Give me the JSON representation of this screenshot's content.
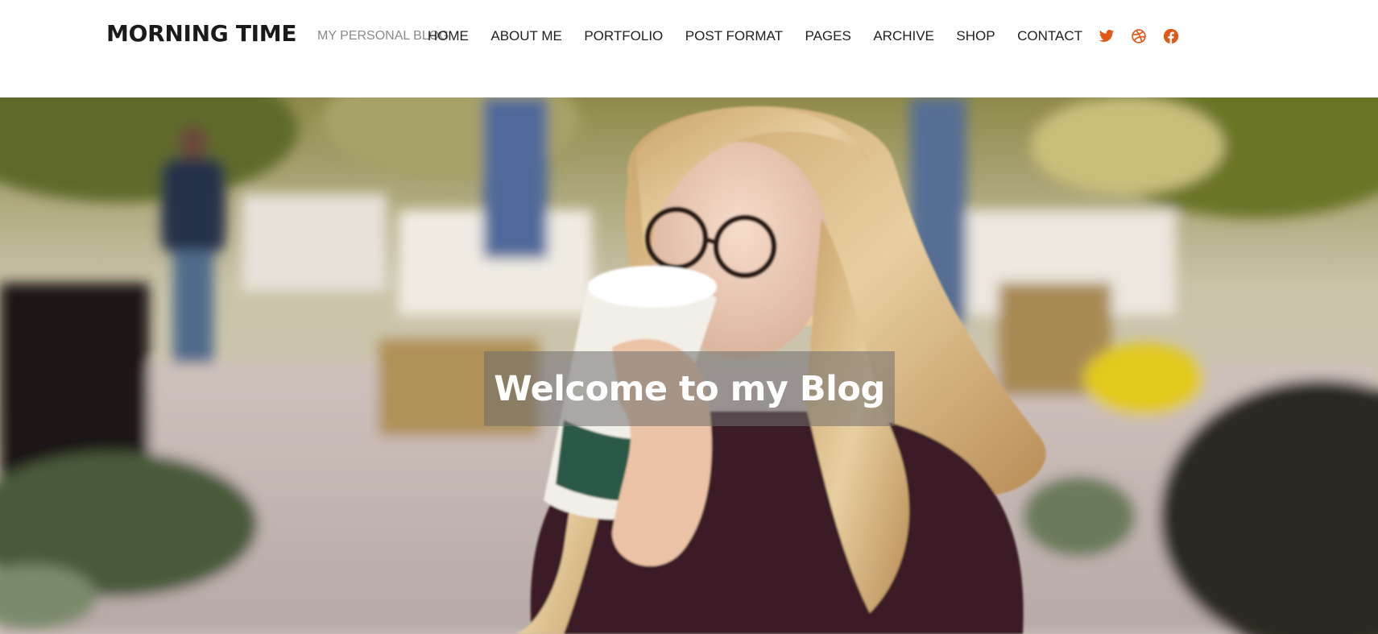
{
  "site": {
    "title": "MORNING TIME",
    "tagline": "MY PERSONAL BLOG"
  },
  "nav": {
    "items": [
      {
        "label": "HOME"
      },
      {
        "label": "ABOUT ME"
      },
      {
        "label": "PORTFOLIO"
      },
      {
        "label": "POST FORMAT"
      },
      {
        "label": "PAGES"
      },
      {
        "label": "ARCHIVE"
      },
      {
        "label": "SHOP"
      },
      {
        "label": "CONTACT"
      }
    ],
    "social": [
      {
        "icon": "twitter-icon"
      },
      {
        "icon": "dribbble-icon"
      },
      {
        "icon": "facebook-icon"
      }
    ]
  },
  "hero": {
    "title": "Welcome to my Blog",
    "image_subject": "woman with glasses drinking coffee in a park"
  },
  "colors": {
    "accent": "#e0591a",
    "text": "#1f1f1f",
    "tagline": "#8a8a8a",
    "header_bg": "#ffffff",
    "caption_overlay": "rgba(110,110,110,0.55)"
  }
}
